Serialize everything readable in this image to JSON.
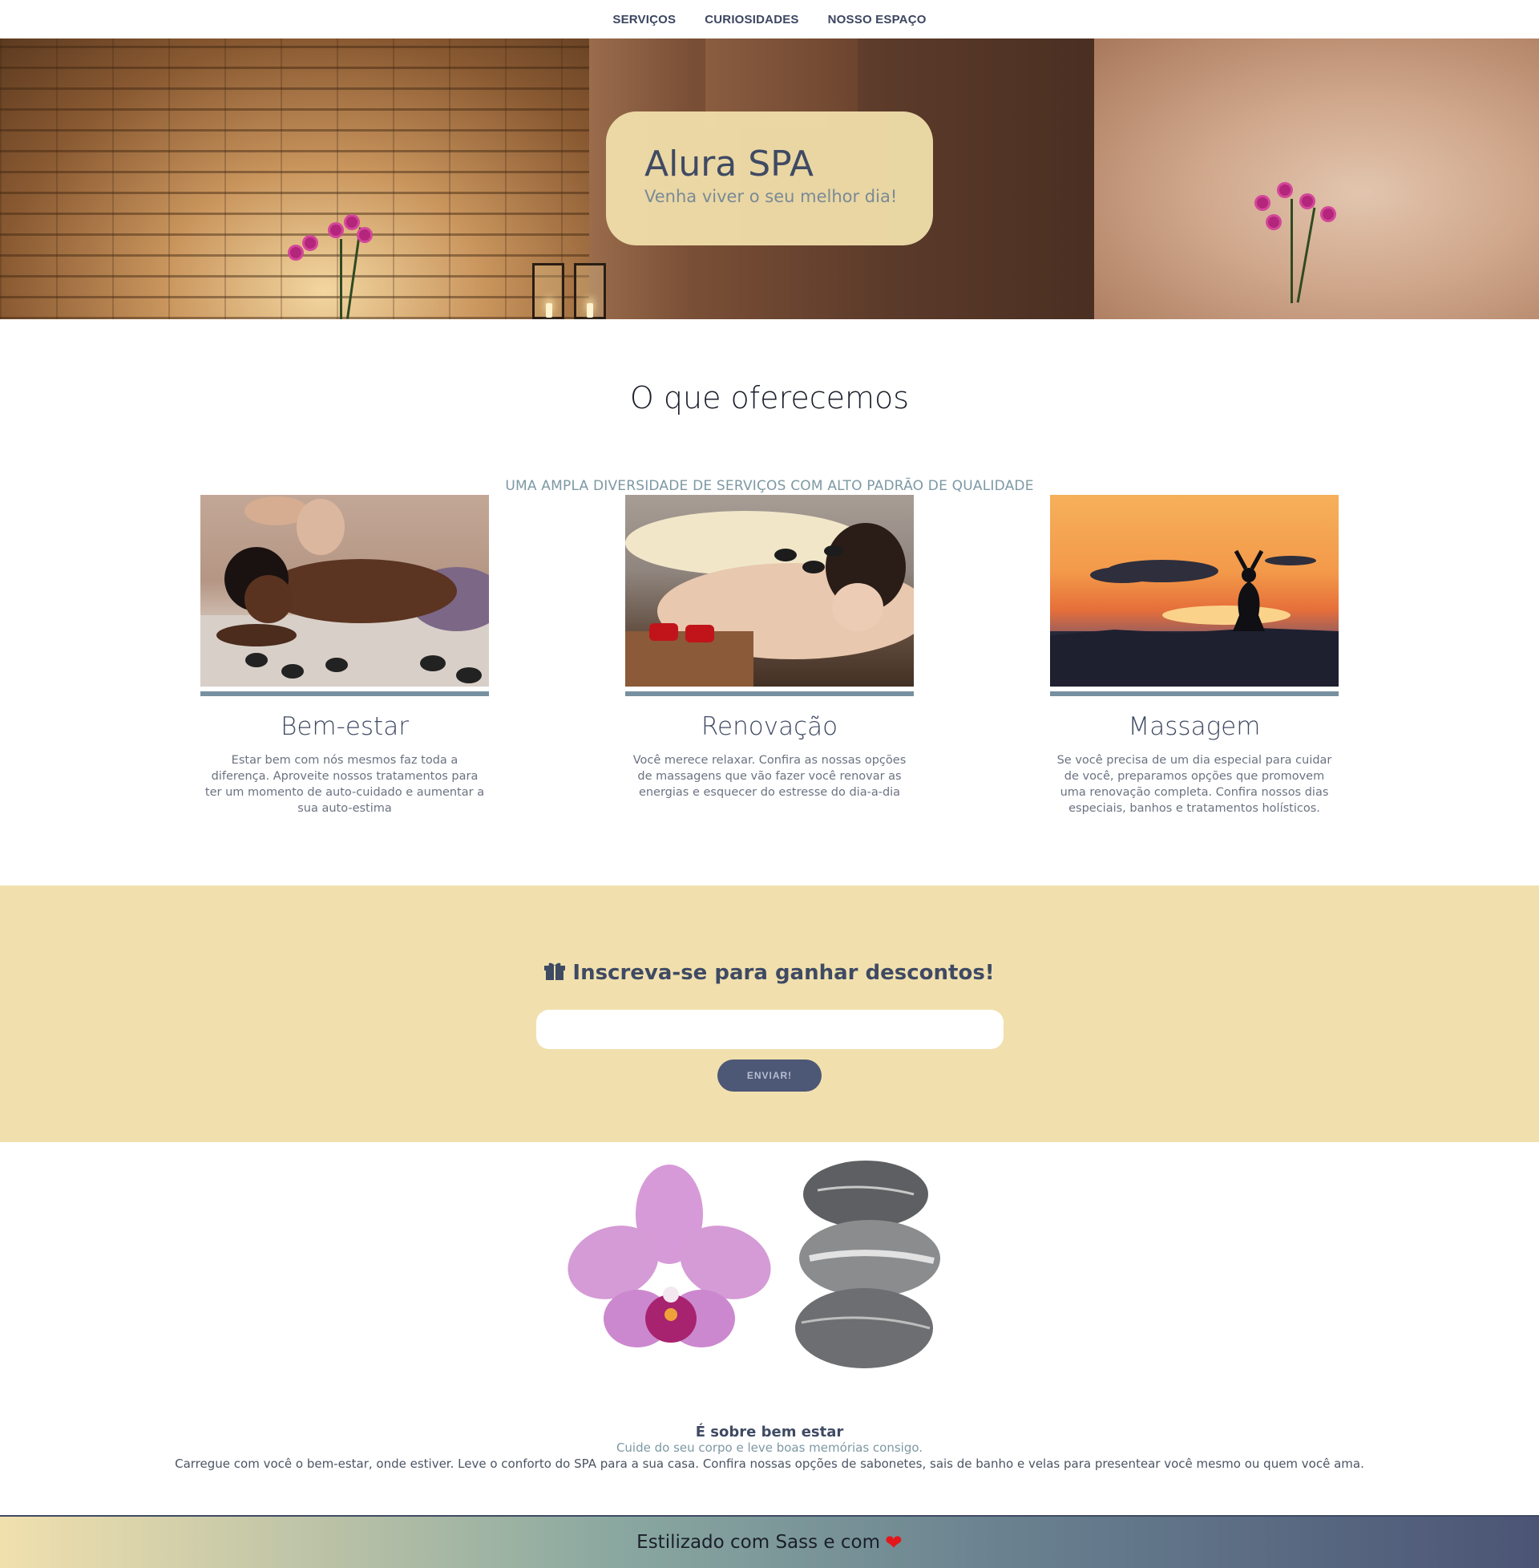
{
  "nav": {
    "items": [
      "SERVIÇOS",
      "CURIOSIDADES",
      "NOSSO ESPAÇO"
    ]
  },
  "hero": {
    "title": "Alura SPA",
    "subtitle": "Venha viver o seu melhor dia!"
  },
  "offer": {
    "title": "O que oferecemos",
    "subtitle": "UMA AMPLA DIVERSIDADE DE SERVIÇOS COM ALTO PADRÃO DE QUALIDADE",
    "cards": [
      {
        "title": "Bem-estar",
        "text": "Estar bem com nós mesmos faz toda a diferença. Aproveite nossos tratamentos para ter um momento de auto-cuidado e aumentar a sua auto-estima"
      },
      {
        "title": "Renovação",
        "text": "Você merece relaxar. Confira as nossas opções de massagens que vão fazer você renovar as energias e esquecer do estresse do dia-a-dia"
      },
      {
        "title": "Massagem",
        "text": "Se você precisa de um dia especial para cuidar de você, preparamos opções que promovem uma renovação completa. Confira nossos dias especiais, banhos e tratamentos holísticos."
      }
    ]
  },
  "subscribe": {
    "title": "Inscreva-se para ganhar descontos!",
    "input_value": "",
    "button_label": "ENVIAR!"
  },
  "wellness": {
    "title": "É sobre bem estar",
    "subtitle": "Cuide do seu corpo e leve boas memórias consigo.",
    "text": "Carregue com você o bem-estar, onde estiver. Leve o conforto do SPA para a sua casa. Confira nossas opções de sabonetes, sais de banho e velas para presentear você mesmo ou quem você ama."
  },
  "footer": {
    "text": "Estilizado com Sass e com"
  },
  "colors": {
    "accent": "#3f4a63",
    "sand": "#f1e0ae",
    "button": "#4d5776",
    "heart": "#e3171b"
  },
  "icons": [
    "gift-icon",
    "heart-icon"
  ]
}
